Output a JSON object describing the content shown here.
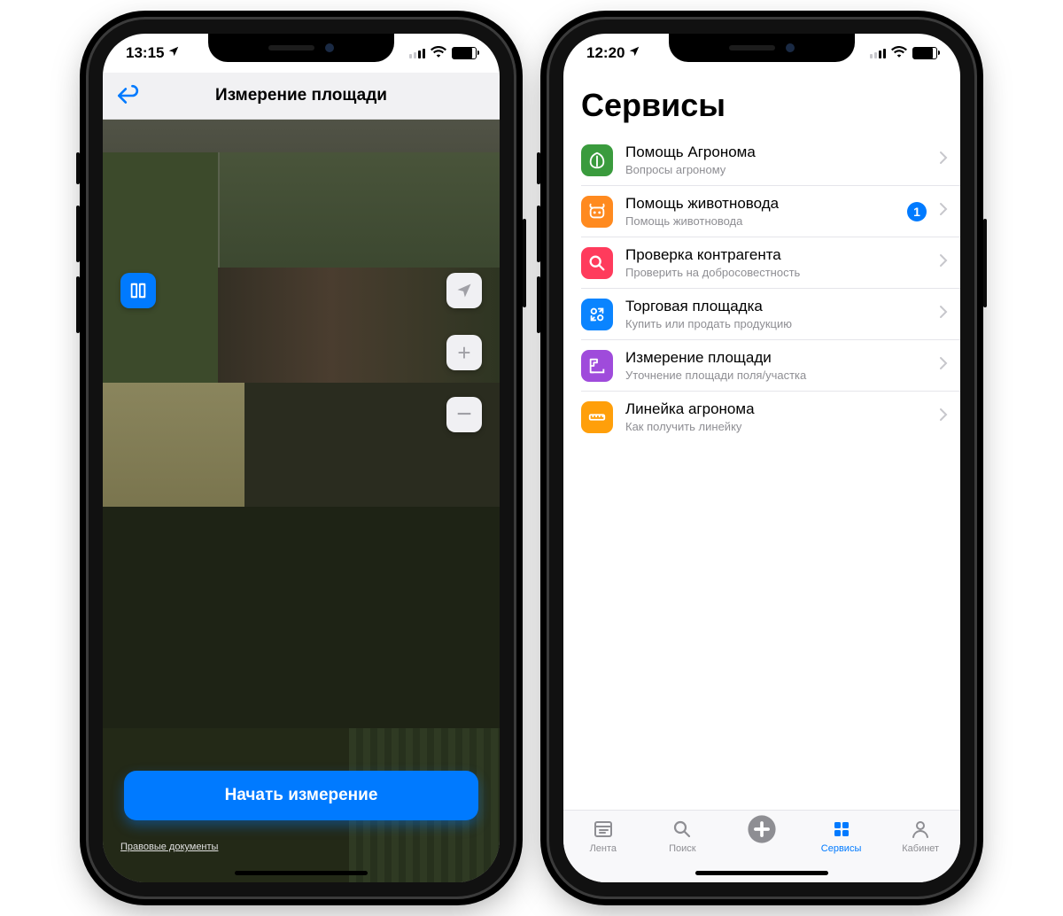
{
  "phone1": {
    "status_time": "13:15",
    "nav_title": "Измерение площади",
    "start_button": "Начать измерение",
    "legal_link": "Правовые документы"
  },
  "phone2": {
    "status_time": "12:20",
    "page_title": "Сервисы",
    "services": [
      {
        "title": "Помощь Агронома",
        "subtitle": "Вопросы агроному",
        "icon": "leaf",
        "color": "#3a9b3d",
        "badge": null
      },
      {
        "title": "Помощь животновода",
        "subtitle": "Помощь животновода",
        "icon": "cow",
        "color": "#ff8a1f",
        "badge": "1"
      },
      {
        "title": "Проверка контрагента",
        "subtitle": "Проверить на добросовестность",
        "icon": "search",
        "color": "#ff3b5c",
        "badge": null
      },
      {
        "title": "Торговая площадка",
        "subtitle": "Купить или продать продукцию",
        "icon": "trade",
        "color": "#0a84ff",
        "badge": null
      },
      {
        "title": "Измерение площади",
        "subtitle": "Уточнение площади поля/участка",
        "icon": "measure",
        "color": "#9f4bdb",
        "badge": null
      },
      {
        "title": "Линейка агронома",
        "subtitle": "Как получить линейку",
        "icon": "ruler",
        "color": "#ff9f0a",
        "badge": null
      }
    ],
    "tabs": [
      {
        "label": "Лента",
        "icon": "feed",
        "active": false
      },
      {
        "label": "Поиск",
        "icon": "search",
        "active": false
      },
      {
        "label": "",
        "icon": "plus",
        "active": false
      },
      {
        "label": "Сервисы",
        "icon": "grid",
        "active": true
      },
      {
        "label": "Кабинет",
        "icon": "profile",
        "active": false
      }
    ]
  }
}
